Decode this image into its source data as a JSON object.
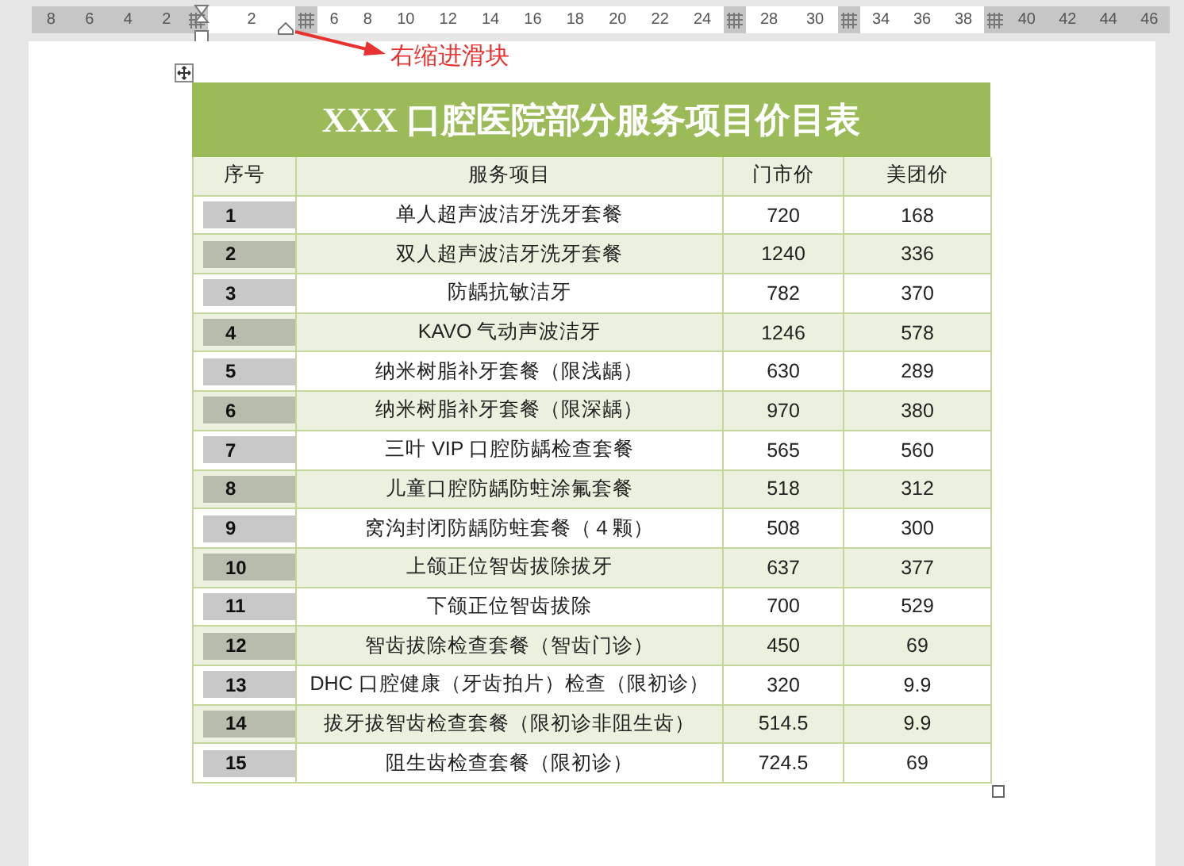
{
  "ruler": {
    "segments": [
      {
        "kind": "margin",
        "labels": [
          "8",
          "6",
          "4",
          "2"
        ]
      },
      {
        "kind": "text",
        "labels": [
          "2"
        ]
      },
      {
        "kind": "text",
        "labels": [
          "6",
          "8",
          "10",
          "12",
          "14",
          "16",
          "18",
          "20",
          "22",
          "24"
        ]
      },
      {
        "kind": "text",
        "labels": [
          "28",
          "30"
        ]
      },
      {
        "kind": "text",
        "labels": [
          "34",
          "36",
          "38"
        ]
      },
      {
        "kind": "margin",
        "labels": [
          "40",
          "42",
          "44",
          "46"
        ]
      }
    ]
  },
  "callout": {
    "label": "右缩进滑块"
  },
  "table": {
    "title": "XXX 口腔医院部分服务项目价目表",
    "columns": [
      "序号",
      "服务项目",
      "门市价",
      "美团价"
    ],
    "rows": [
      [
        "1",
        "单人超声波洁牙洗牙套餐",
        "720",
        "168"
      ],
      [
        "2",
        "双人超声波洁牙洗牙套餐",
        "1240",
        "336"
      ],
      [
        "3",
        "防龋抗敏洁牙",
        "782",
        "370"
      ],
      [
        "4",
        "KAVO 气动声波洁牙",
        "1246",
        "578"
      ],
      [
        "5",
        "纳米树脂补牙套餐（限浅龋）",
        "630",
        "289"
      ],
      [
        "6",
        "纳米树脂补牙套餐（限深龋）",
        "970",
        "380"
      ],
      [
        "7",
        "三叶 VIP 口腔防龋检查套餐",
        "565",
        "560"
      ],
      [
        "8",
        "儿童口腔防龋防蛀涂氟套餐",
        "518",
        "312"
      ],
      [
        "9",
        "窝沟封闭防龋防蛀套餐（４颗）",
        "508",
        "300"
      ],
      [
        "10",
        "上颌正位智齿拔除拔牙",
        "637",
        "377"
      ],
      [
        "11",
        "下颌正位智齿拔除",
        "700",
        "529"
      ],
      [
        "12",
        "智齿拔除检查套餐（智齿门诊）",
        "450",
        "69"
      ],
      [
        "13",
        "DHC 口腔健康（牙齿拍片）检查（限初诊）",
        "320",
        "9.9"
      ],
      [
        "14",
        "拔牙拔智齿检查套餐（限初诊非阻生齿）",
        "514.5",
        "9.9"
      ],
      [
        "15",
        "阻生齿检查套餐（限初诊）",
        "724.5",
        "69"
      ]
    ]
  }
}
